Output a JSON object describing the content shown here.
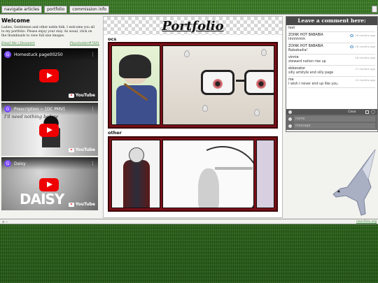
{
  "nav": {
    "items": [
      "navigate articles",
      "portfolio",
      "commission info"
    ]
  },
  "welcome": {
    "title": "Welcome",
    "text": "Ladies, Gentlemen and other noble folk. I welcome you all to my portfolio. Please enjoy your stay. As usual, click on the thumbnails to view full size images.",
    "email_link": "Email Me | Deviantrt",
    "placeholder_link": "Placeholder#7681"
  },
  "videos": [
    {
      "avatar": "G",
      "title": "Homestuck page00250"
    },
    {
      "avatar": "G",
      "title": "Prescription ~ [OC PMV]",
      "scribble": "I'll need nothing before"
    },
    {
      "avatar": "G",
      "title": "Daisy",
      "overlay": "DAISY"
    }
  ],
  "youtube_label": "YouTube",
  "portfolio": {
    "title": "Portfolio",
    "section_ocs": "ocs",
    "section_other": "other"
  },
  "comments": {
    "header": "Leave a comment here:",
    "items": [
      {
        "name": "test",
        "time": "",
        "message": ""
      },
      {
        "name": "ZOINK HOT BABABIA",
        "time": "16 months ago",
        "message": "hhhhhhhh"
      },
      {
        "name": "ZOINK HOT BABABIA",
        "time": "16 months ago",
        "message": "Bababadia!"
      },
      {
        "name": "vinnie",
        "time": "16 months ago",
        "message": "steward nation rise up"
      },
      {
        "name": "ekkonator",
        "time": "17 months ago",
        "message": "silly artstyle and silly page"
      },
      {
        "name": "me",
        "time": "12 months ago",
        "message": "I wish I never end up like you."
      }
    ],
    "clear_label": "Clear",
    "name_placeholder": "name",
    "message_placeholder": "message"
  },
  "bottom": {
    "icons": "⚙ —",
    "link": "neocities.org"
  }
}
